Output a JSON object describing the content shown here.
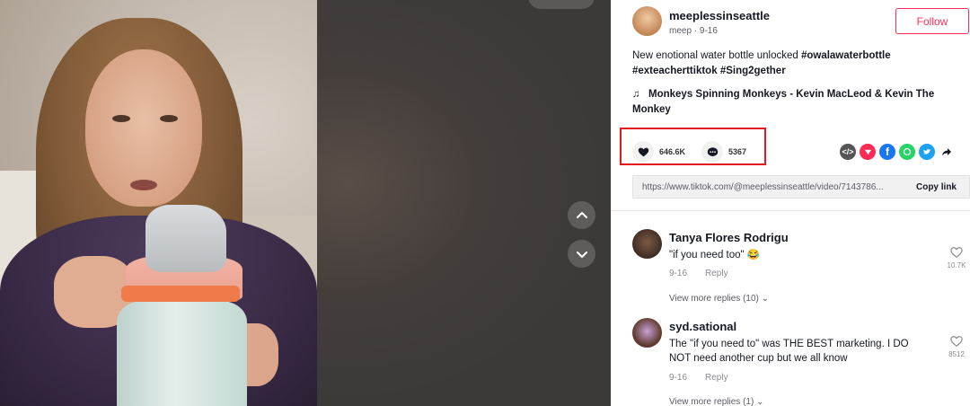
{
  "post": {
    "username": "meeplessinseattle",
    "subline": "meep · 9-16",
    "follow_label": "Follow",
    "caption_text": "New enotional water bottle unlocked ",
    "hashtags": [
      "#owalawaterbottle",
      "#exteacherttiktok",
      "#Sing2gether"
    ],
    "music": "Monkeys Spinning Monkeys - Kevin MacLeod & Kevin The Monkey",
    "likes": "646.6K",
    "comments": "5367"
  },
  "share": {
    "icons": [
      "embed-icon",
      "send-icon",
      "facebook-icon",
      "whatsapp-icon",
      "twitter-icon",
      "share-arrow-icon"
    ],
    "colors": {
      "embed": "#555555",
      "send": "#fe2c55",
      "facebook": "#1877f2",
      "whatsapp": "#25d366",
      "twitter": "#1da1f2"
    }
  },
  "link": {
    "url": "https://www.tiktok.com/@meeplessinseattle/video/7143786...",
    "copy_label": "Copy link"
  },
  "comments": [
    {
      "name": "Tanya Flores Rodrigu",
      "text": "\"if you need too\" 😂",
      "date": "9-16",
      "reply": "Reply",
      "likes": "10.7K",
      "view_more": "View more replies (10)"
    },
    {
      "name": "syd.sational",
      "text": "The \"if you need to\" was THE BEST marketing. I DO NOT need another cup but we all know",
      "date": "9-16",
      "reply": "Reply",
      "likes": "8512",
      "view_more": "View more replies (1)"
    }
  ],
  "colors": {
    "accent": "#fe2c55",
    "highlight": "#e8191e"
  }
}
